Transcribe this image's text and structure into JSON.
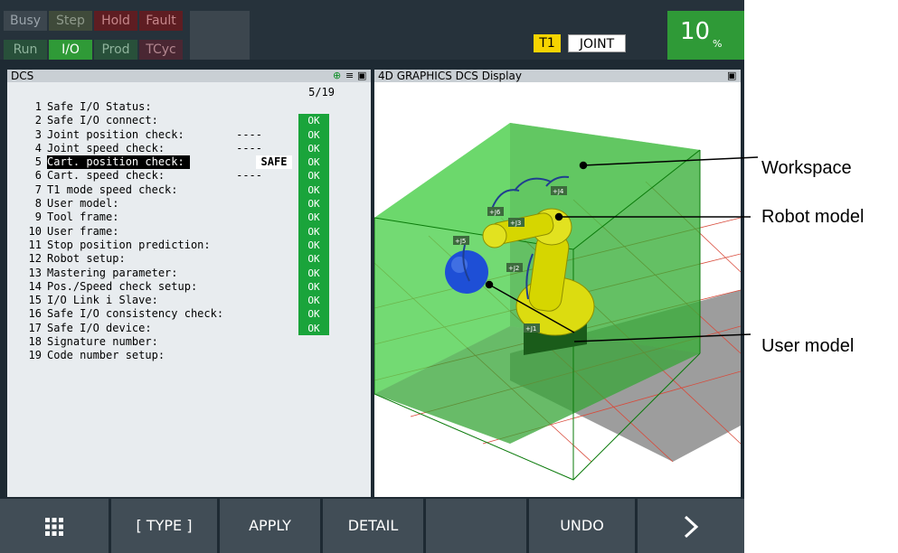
{
  "status_lamps": [
    {
      "label": "Busy",
      "style": "gray"
    },
    {
      "label": "Step",
      "style": "dolive"
    },
    {
      "label": "Hold",
      "style": "dred"
    },
    {
      "label": "Fault",
      "style": "dred"
    },
    {
      "label": "Run",
      "style": "dgreen"
    },
    {
      "label": "I/O",
      "style": "green"
    },
    {
      "label": "Prod",
      "style": "dgreen"
    },
    {
      "label": "TCyc",
      "style": "dmag"
    }
  ],
  "mode": {
    "t1": "T1",
    "coord": "JOINT"
  },
  "override": {
    "value": "10",
    "unit": "%"
  },
  "dcs": {
    "title": "DCS",
    "page": "5/19",
    "rows": [
      {
        "num": "1",
        "label": "Safe I/O Status:",
        "value": "",
        "status": ""
      },
      {
        "num": "2",
        "label": "Safe I/O connect:",
        "value": "",
        "status": "OK"
      },
      {
        "num": "3",
        "label": "Joint position check:",
        "value": "----",
        "status": "OK"
      },
      {
        "num": "4",
        "label": "Joint speed check:",
        "value": "----",
        "status": "OK"
      },
      {
        "num": "5",
        "label": "Cart. position check:",
        "value": "SAFE",
        "status": "OK",
        "selected": true
      },
      {
        "num": "6",
        "label": "Cart. speed check:",
        "value": "----",
        "status": "OK"
      },
      {
        "num": "7",
        "label": "T1 mode speed check:",
        "value": "",
        "status": "OK"
      },
      {
        "num": "8",
        "label": "User model:",
        "value": "",
        "status": "OK"
      },
      {
        "num": "9",
        "label": "Tool frame:",
        "value": "",
        "status": "OK"
      },
      {
        "num": "10",
        "label": "User frame:",
        "value": "",
        "status": "OK"
      },
      {
        "num": "11",
        "label": "Stop position prediction:",
        "value": "",
        "status": "OK"
      },
      {
        "num": "12",
        "label": "Robot setup:",
        "value": "",
        "status": "OK"
      },
      {
        "num": "13",
        "label": "Mastering parameter:",
        "value": "",
        "status": "OK"
      },
      {
        "num": "14",
        "label": "Pos./Speed check setup:",
        "value": "",
        "status": "OK"
      },
      {
        "num": "15",
        "label": "I/O Link i Slave:",
        "value": "",
        "status": "OK"
      },
      {
        "num": "16",
        "label": "Safe I/O consistency check:",
        "value": "",
        "status": "OK"
      },
      {
        "num": "17",
        "label": "Safe I/O device:",
        "value": "",
        "status": "OK"
      },
      {
        "num": "18",
        "label": "Signature number:",
        "value": "",
        "status": ""
      },
      {
        "num": "19",
        "label": "Code number setup:",
        "value": "",
        "status": ""
      }
    ]
  },
  "graphics": {
    "title": "4D GRAPHICS DCS Display",
    "joint_labels": [
      "+J1",
      "+J2",
      "+J3",
      "+J4",
      "+J5",
      "+J6"
    ]
  },
  "fkeys": {
    "menu_icon": "grid-menu-icon",
    "type": "[ TYPE ]",
    "apply": "APPLY",
    "detail": "DETAIL",
    "blank": "",
    "undo": "UNDO",
    "next_icon": "chevron-right-icon"
  },
  "callouts": {
    "workspace": "Workspace",
    "robot_model": "Robot model",
    "user_model": "User model"
  },
  "colors": {
    "ok_green": "#1aa43b",
    "t1_yellow": "#f6d400",
    "workspace_green": "#3fbf3f",
    "robot_yellow": "#e6e600",
    "user_model_blue": "#1e4fd6"
  }
}
